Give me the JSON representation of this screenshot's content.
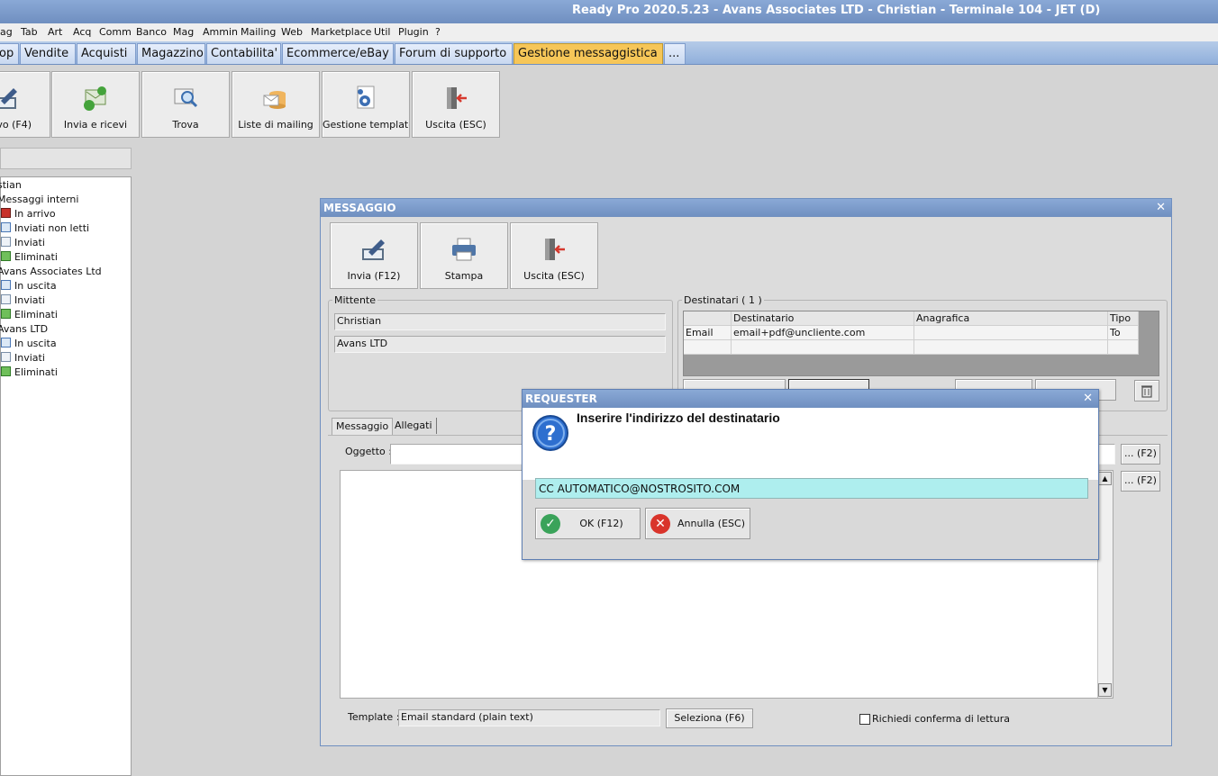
{
  "app": {
    "title": "Ready Pro 2020.5.23 - Avans Associates LTD - Christian - Terminale 104 - JET (D)"
  },
  "menu": [
    "ag",
    "Tab",
    "Art",
    "Acq",
    "Comm",
    "Banco",
    "Mag",
    "Ammin",
    "Mailing",
    "Web",
    "Marketplace",
    "Util",
    "Plugin",
    "?"
  ],
  "tabs": [
    "op",
    "Vendite",
    "Acquisti",
    "Magazzino",
    "Contabilita'",
    "Ecommerce/eBay",
    "Forum di supporto",
    "Gestione messaggistica",
    "..."
  ],
  "toolbar": {
    "new_label": "vo (F4)",
    "sendrecv_label": "Invia e ricevi",
    "find_label": "Trova",
    "lists_label": "Liste di mailing",
    "templates_label": "Gestione template",
    "exit_label": "Uscita (ESC)"
  },
  "tree": [
    "stian",
    "Messaggi interni",
    "In arrivo",
    "Inviati non letti",
    "Inviati",
    "Eliminati",
    "Avans Associates Ltd",
    "In uscita",
    "Inviati",
    "Eliminati",
    "Avans  LTD",
    "In uscita",
    "Inviati",
    "Eliminati"
  ],
  "message_window": {
    "title": "MESSAGGIO",
    "close": "✕",
    "send_label": "Invia (F12)",
    "print_label": "Stampa",
    "exit_label": "Uscita (ESC)",
    "sender_label": "Mittente",
    "sender_name": "Christian",
    "sender_company": "Avans  LTD",
    "recipients_label": "Destinatari ( 1 )",
    "recipients_headers": [
      "Destinatario",
      "Anagrafica",
      "Tipo"
    ],
    "recipients_rows": [
      {
        "channel": "Email",
        "address": "email+pdf@uncliente.com",
        "registry": "",
        "type": "To"
      }
    ],
    "tab_message": "Messaggio",
    "tab_attachments": "Allegati",
    "subject_label": "Oggetto :",
    "subject_value": "",
    "f2_label": "... (F2)",
    "template_label": "Template :",
    "template_value": "Email standard (plain text)",
    "select_label": "Seleziona (F6)",
    "read_receipt_label": "Richiedi conferma di lettura",
    "read_receipt_checked": false
  },
  "requester": {
    "title": "REQUESTER",
    "close": "✕",
    "question": "Inserire l'indirizzo del destinatario",
    "input_value": "CC AUTOMATICO@NOSTROSITO.COM",
    "ok_label": "OK (F12)",
    "cancel_label": "Annulla (ESC)"
  },
  "colors": {
    "title_bar": "#6f8fc0",
    "active_tab": "#f6c658",
    "input_highlight": "#aeeeee",
    "ok_green": "#3aa35a",
    "cancel_red": "#d9342b",
    "help_blue": "#2e6fcf"
  },
  "icons": [
    "edit-icon",
    "send-receive-icon",
    "search-icon",
    "mailing-list-icon",
    "template-gear-icon",
    "exit-door-icon",
    "printer-icon",
    "question-icon",
    "check-icon",
    "cancel-icon",
    "trash-icon"
  ]
}
